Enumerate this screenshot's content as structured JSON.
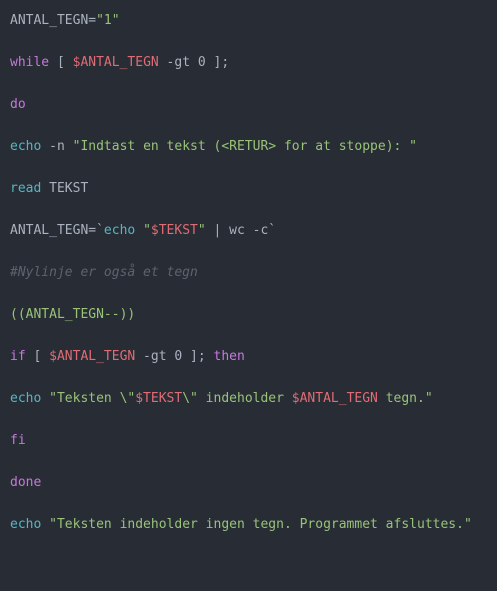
{
  "colors": {
    "background": "#282c34",
    "keyword": "#c678dd",
    "builtin": "#56b6c2",
    "variable": "#e06c75",
    "string": "#98c379",
    "comment": "#5c6370",
    "plain": "#abb2bf"
  },
  "code": {
    "lines": [
      [
        {
          "t": "ANTAL_TEGN=",
          "c": "pl"
        },
        {
          "t": "\"1\"",
          "c": "str"
        }
      ],
      [
        {
          "t": "while",
          "c": "kw"
        },
        {
          "t": " [ ",
          "c": "pl"
        },
        {
          "t": "$ANTAL_TEGN",
          "c": "var"
        },
        {
          "t": " -gt 0 ];",
          "c": "pl"
        }
      ],
      [
        {
          "t": "do",
          "c": "kw"
        }
      ],
      [
        {
          "t": "echo",
          "c": "fn"
        },
        {
          "t": " -n ",
          "c": "pl"
        },
        {
          "t": "\"Indtast en tekst (<RETUR> for at stoppe): \"",
          "c": "str"
        }
      ],
      [
        {
          "t": "read",
          "c": "fn"
        },
        {
          "t": " TEKST",
          "c": "pl"
        }
      ],
      [
        {
          "t": "ANTAL_TEGN=`",
          "c": "pl"
        },
        {
          "t": "echo",
          "c": "fn"
        },
        {
          "t": " ",
          "c": "pl"
        },
        {
          "t": "\"",
          "c": "str"
        },
        {
          "t": "$TEKST",
          "c": "var"
        },
        {
          "t": "\"",
          "c": "str"
        },
        {
          "t": " | wc -c`",
          "c": "pl"
        }
      ],
      [
        {
          "t": "#Nylinje er også et tegn",
          "c": "cmt"
        }
      ],
      [
        {
          "t": "((ANTAL_TEGN--))",
          "c": "str"
        }
      ],
      [
        {
          "t": "if",
          "c": "kw"
        },
        {
          "t": " [ ",
          "c": "pl"
        },
        {
          "t": "$ANTAL_TEGN",
          "c": "var"
        },
        {
          "t": " -gt 0 ]; ",
          "c": "pl"
        },
        {
          "t": "then",
          "c": "kw"
        }
      ],
      [
        {
          "t": "echo",
          "c": "fn"
        },
        {
          "t": " ",
          "c": "pl"
        },
        {
          "t": "\"Teksten \\\"",
          "c": "str"
        },
        {
          "t": "$TEKST",
          "c": "var"
        },
        {
          "t": "\\\" indeholder ",
          "c": "str"
        },
        {
          "t": "$ANTAL_TEGN",
          "c": "var"
        },
        {
          "t": " tegn.\"",
          "c": "str"
        }
      ],
      [
        {
          "t": "fi",
          "c": "kw"
        }
      ],
      [
        {
          "t": "done",
          "c": "kw"
        }
      ],
      [
        {
          "t": "echo",
          "c": "fn"
        },
        {
          "t": " ",
          "c": "pl"
        },
        {
          "t": "\"Teksten indeholder ingen tegn. Programmet afsluttes.\"",
          "c": "str"
        }
      ]
    ]
  }
}
